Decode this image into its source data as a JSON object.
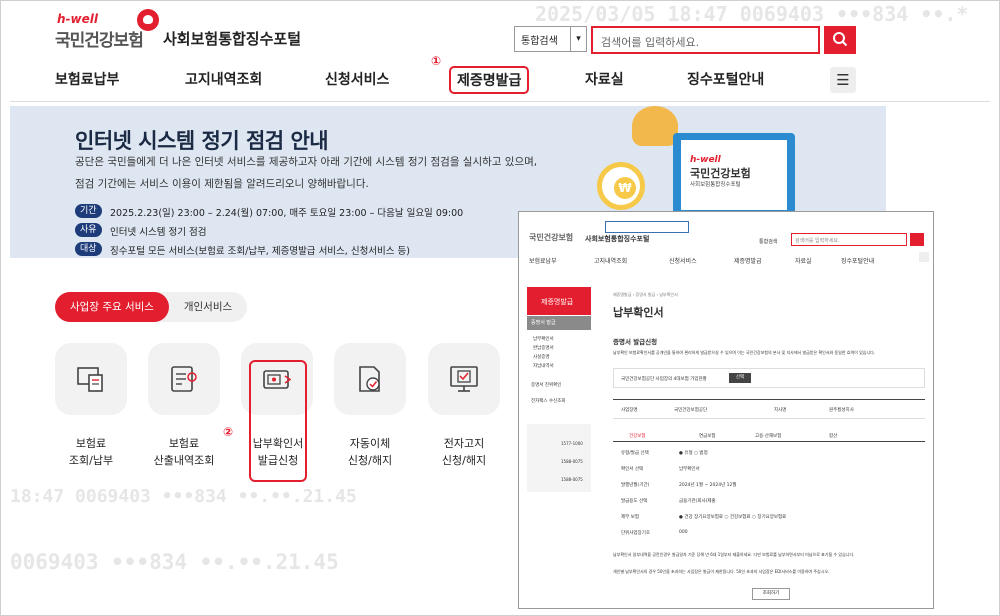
{
  "watermarks": [
    "2025/03/05 18:47 0069403 •••834 ••.*",
    "18:47 0069403 •••834 ••.••.21.45",
    "0069403 •••834 ••.••.21.45"
  ],
  "header": {
    "brand_small": "h-well",
    "brand_main": "국민건강보험",
    "portal_name": "사회보험통합징수포털",
    "search_scope": "통합검색",
    "search_placeholder": "검색어를 입력하세요."
  },
  "nav": {
    "items": [
      "보험료납부",
      "고지내역조회",
      "신청서비스",
      "제증명발급",
      "자료실",
      "징수포털안내"
    ],
    "active_index": 3
  },
  "steps": [
    "①",
    "②"
  ],
  "banner": {
    "title": "인터넷 시스템 정기 점검 안내",
    "desc1": "공단은 국민들에게 더 나은 인터넷 서비스를 제공하고자 아래 기간에 시스템 정기 점검을 실시하고 있으며,",
    "desc2": "점검 기간에는 서비스 이용이 제한됨을 알려드리오니 양해바랍니다.",
    "rows": [
      {
        "tag": "기간",
        "text": "2025.2.23(일) 23:00 – 2.24(월) 07:00, 매주 토요일 23:00 – 다음날 일요일 09:00"
      },
      {
        "tag": "사유",
        "text": "인터넷 시스템 정기 점검"
      },
      {
        "tag": "대상",
        "text": "징수포털 모든 서비스(보험료 조회/납부, 제증명발급 서비스, 신청서비스 등)"
      }
    ],
    "illustration_brand": "h-well",
    "illustration_main": "국민건강보험",
    "illustration_sub": "사회보험통합징수포털",
    "coin_symbol": "₩"
  },
  "tabs": {
    "active": "사업장 주요 서비스",
    "inactive": "개인서비스"
  },
  "services": [
    {
      "l1": "보험료",
      "l2": "조회/납부",
      "icon": "receipt-icon"
    },
    {
      "l1": "보험료",
      "l2": "산출내역조회",
      "icon": "calculation-list-icon"
    },
    {
      "l1": "납부확인서",
      "l2": "발급신청",
      "icon": "certificate-icon"
    },
    {
      "l1": "자동이체",
      "l2": "신청/해지",
      "icon": "auto-transfer-icon"
    },
    {
      "l1": "전자고지",
      "l2": "신청/해지",
      "icon": "e-notice-icon"
    }
  ],
  "inset": {
    "brand_main": "국민건강보험",
    "portal_name": "사회보험통합징수포털",
    "search_scope": "통합검색",
    "search_placeholder": "검색어를 입력하세요.",
    "nav": [
      "보험료납부",
      "고지내역조회",
      "신청서비스",
      "제증명발급",
      "자료실",
      "징수포털안내"
    ],
    "side_title": "제증명발급",
    "side_section": "증명서 발급",
    "side_items": [
      "납부확인서",
      "완납증명서",
      "사실증명",
      "자납내역서"
    ],
    "side_extra": [
      "증명서 진위확인",
      "전자팩스 수신조회"
    ],
    "breadcrumb": "제증명발급 › 증명서 발급 › 납부확인서",
    "page_title": "납부확인서",
    "section_title": "증명서 발급신청",
    "notice": "납부확인 보험료확인서를 공개인을 통하여 편리하게 발급받으실 수 있으며 이는 국민건강보험의 본사 및 지사에서 발급받은 확인서와 동일한 효력이 있습니다.",
    "member_label": "국민건강보험공단 사업장의 4대보험 가입현황",
    "member_btn": "선택",
    "biz_label": "사업장명",
    "biz_value": "국민건강보험공단",
    "branch_label": "지사명",
    "branch_value": "원주횡성지사",
    "form_tabs": [
      "건강보험",
      "연금보험",
      "고용·산재보험",
      "합산"
    ],
    "form_rows": [
      {
        "label": "유형/발급 선택",
        "value": "● 유형   ○ 법정"
      },
      {
        "label": "확인서 선택",
        "value": "납부확인서"
      },
      {
        "label": "발행년월(기간)",
        "value": "2024년 1월 ~ 2024년 12월"
      },
      {
        "label": "발급용도 선택",
        "value": "금융기관(회사)제출"
      },
      {
        "label": "제부 보험",
        "value": "● 건강 장기요양보험료   ○ 건강보험료   ○ 장기요양보험료"
      },
      {
        "label": "단위사업장기호",
        "value": "000"
      }
    ],
    "footnote1": "납부확인서 일부내역을 공란인경우 발급일자 기준 당해 년 6대 1일부터 제출하세요. 다만 보험료를 납부하면서부터 미납으로 표기될 수 있습니다.",
    "footnote2": "개인별 납부확인서의 경우 50인을 초과하는 사업장은 발급이 제한됩니다. 50인 초과의 사업장은 EDI서비스를 이용하여 주십시오.",
    "submit_label": "조회하기",
    "phones": [
      "1577-1000",
      "1588-0075",
      "1588-0075"
    ]
  }
}
